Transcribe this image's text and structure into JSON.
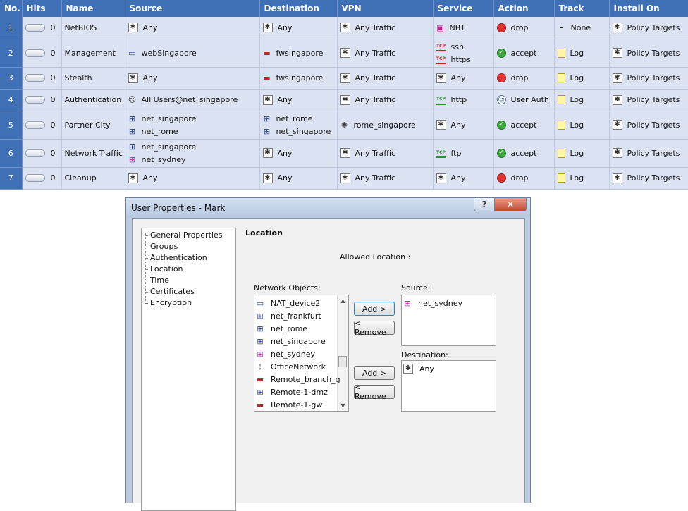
{
  "table": {
    "headers": [
      "No.",
      "Hits",
      "Name",
      "Source",
      "Destination",
      "VPN",
      "Service",
      "Action",
      "Track",
      "Install On"
    ],
    "rows": [
      {
        "no": "1",
        "hits": "0",
        "name": "NetBIOS",
        "source": [
          "Any"
        ],
        "destination": [
          "Any"
        ],
        "vpn": "Any Traffic",
        "service": [
          "NBT"
        ],
        "action": "drop",
        "track": "None",
        "install": "Policy Targets"
      },
      {
        "no": "2",
        "hits": "0",
        "name": "Management",
        "source": [
          "webSingapore"
        ],
        "destination": [
          "fwsingapore"
        ],
        "vpn": "Any Traffic",
        "service": [
          "ssh",
          "https"
        ],
        "action": "accept",
        "track": "Log",
        "install": "Policy Targets"
      },
      {
        "no": "3",
        "hits": "0",
        "name": "Stealth",
        "source": [
          "Any"
        ],
        "destination": [
          "fwsingapore"
        ],
        "vpn": "Any Traffic",
        "service": [
          "Any"
        ],
        "action": "drop",
        "track": "Log",
        "install": "Policy Targets"
      },
      {
        "no": "4",
        "hits": "0",
        "name": "Authentication",
        "source": [
          "All Users@net_singapore"
        ],
        "destination": [
          "Any"
        ],
        "vpn": "Any Traffic",
        "service": [
          "http"
        ],
        "action": "User Auth",
        "track": "Log",
        "install": "Policy Targets"
      },
      {
        "no": "5",
        "hits": "0",
        "name": "Partner City",
        "source": [
          "net_singapore",
          "net_rome"
        ],
        "destination": [
          "net_rome",
          "net_singapore"
        ],
        "vpn": "rome_singapore",
        "service": [
          "Any"
        ],
        "action": "accept",
        "track": "Log",
        "install": "Policy Targets"
      },
      {
        "no": "6",
        "hits": "0",
        "name": "Network Traffic",
        "source": [
          "net_singapore",
          "net_sydney"
        ],
        "destination": [
          "Any"
        ],
        "vpn": "Any Traffic",
        "service": [
          "ftp"
        ],
        "action": "accept",
        "track": "Log",
        "install": "Policy Targets"
      },
      {
        "no": "7",
        "hits": "0",
        "name": "Cleanup",
        "source": [
          "Any"
        ],
        "destination": [
          "Any"
        ],
        "vpn": "Any Traffic",
        "service": [
          "Any"
        ],
        "action": "drop",
        "track": "Log",
        "install": "Policy Targets"
      }
    ],
    "tcp_label": "TCP"
  },
  "dialog": {
    "title": "User Properties - Mark",
    "help_glyph": "?",
    "close_glyph": "✕",
    "tree": [
      "General Properties",
      "Groups",
      "Authentication",
      "Location",
      "Time",
      "Certificates",
      "Encryption"
    ],
    "section_title": "Location",
    "allowed_location": "Allowed Location :",
    "network_objects_label": "Network Objects:",
    "network_objects": [
      "NAT_device2",
      "net_frankfurt",
      "net_rome",
      "net_singapore",
      "net_sydney",
      "OfficeNetwork",
      "Remote_branch_g",
      "Remote-1-dmz",
      "Remote-1-gw"
    ],
    "source_label": "Source:",
    "source_items": [
      "net_sydney"
    ],
    "destination_label": "Destination:",
    "destination_items": [
      "Any"
    ],
    "add_label": "Add >",
    "remove_label": "< Remove"
  },
  "colors": {
    "header_blue": "#3f70b5",
    "row_bg": "#dbe3f3",
    "drop_red": "#e03030",
    "accept_green": "#3aa53a"
  }
}
